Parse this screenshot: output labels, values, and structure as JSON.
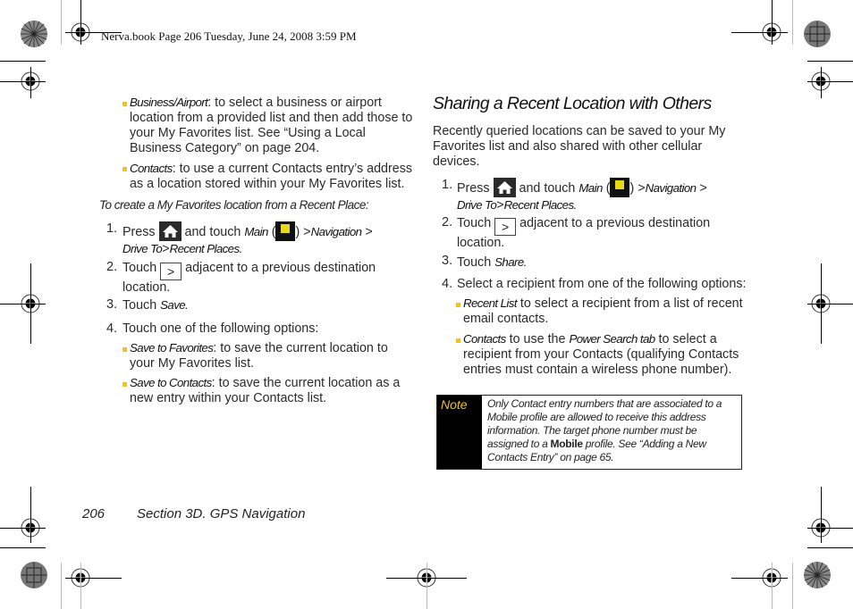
{
  "header": {
    "print_info": "Nerva.book  Page 206  Tuesday, June 24, 2008  3:59 PM"
  },
  "left_column": {
    "bullets_top": [
      {
        "term": "Business/Airport",
        "text": ": to select a business or airport location from a provided list and then add those to your My Favorites list. See “Using a Local Business Category” on page 204."
      },
      {
        "term": "Contacts",
        "text": ": to use a current Contacts entry’s address as a location stored within your My Favorites list."
      }
    ],
    "procedure_title": "To create a My Favorites location from a Recent Place:",
    "steps": [
      {
        "num": "1.",
        "press": "Press",
        "and_touch": "and touch",
        "main": "Main",
        "open_paren": "(",
        "close_paren": ")",
        "sep": ">",
        "nav": "Navigation",
        "drive_to": "Drive To",
        "recent": "Recent Places."
      },
      {
        "num": "2.",
        "touch": "Touch",
        "rest": "adjacent to a previous destination location."
      },
      {
        "num": "3.",
        "touch": "Touch",
        "action": "Save."
      },
      {
        "num": "4.",
        "text": "Touch one of the following options:"
      }
    ],
    "options": [
      {
        "term": "Save to Favorites",
        "text": ": to save the current location to your My Favorites list."
      },
      {
        "term": "Save to Contacts",
        "text": ": to save the current location as a new entry within your Contacts list."
      }
    ]
  },
  "right_column": {
    "heading": "Sharing a Recent Location with Others",
    "intro": "Recently queried locations can be saved to your My Favorites list and also shared with other cellular devices.",
    "steps": [
      {
        "num": "1.",
        "press": "Press",
        "and_touch": "and touch",
        "main": "Main",
        "open_paren": "(",
        "close_paren": ")",
        "sep": ">",
        "nav": "Navigation",
        "drive_to": "Drive To",
        "recent": "Recent Places."
      },
      {
        "num": "2.",
        "touch": "Touch",
        "rest": "adjacent to a previous destination location."
      },
      {
        "num": "3.",
        "touch": "Touch",
        "action": "Share."
      },
      {
        "num": "4.",
        "text": "Select a recipient from one of the following options:"
      }
    ],
    "options": [
      {
        "term": "Recent List",
        "text": " to select a recipient from a list of recent email contacts."
      },
      {
        "term": "Contacts",
        "mid": " to use the ",
        "term2": "Power Search tab",
        "text": " to select a recipient from your Contacts (qualifying Contacts entries must contain a wireless phone number)."
      }
    ],
    "note": {
      "label": "Note",
      "text_before": "Only Contact entry numbers that are associated to a Mobile profile are allowed to receive this address information. The target phone number must be assigned to a ",
      "bold": "Mobile",
      "text_after": " profile. See “Adding a New Contacts Entry” on page 65."
    }
  },
  "icons": {
    "home": "home-icon",
    "main": "main-menu-icon",
    "main_icon_label": "Main",
    "chevron": ">"
  },
  "footer": {
    "page_number": "206",
    "section": "Section 3D. GPS Navigation"
  },
  "colors": {
    "bullet": "#f0c419",
    "note_label": "#f0c419",
    "note_bg": "#000000"
  }
}
